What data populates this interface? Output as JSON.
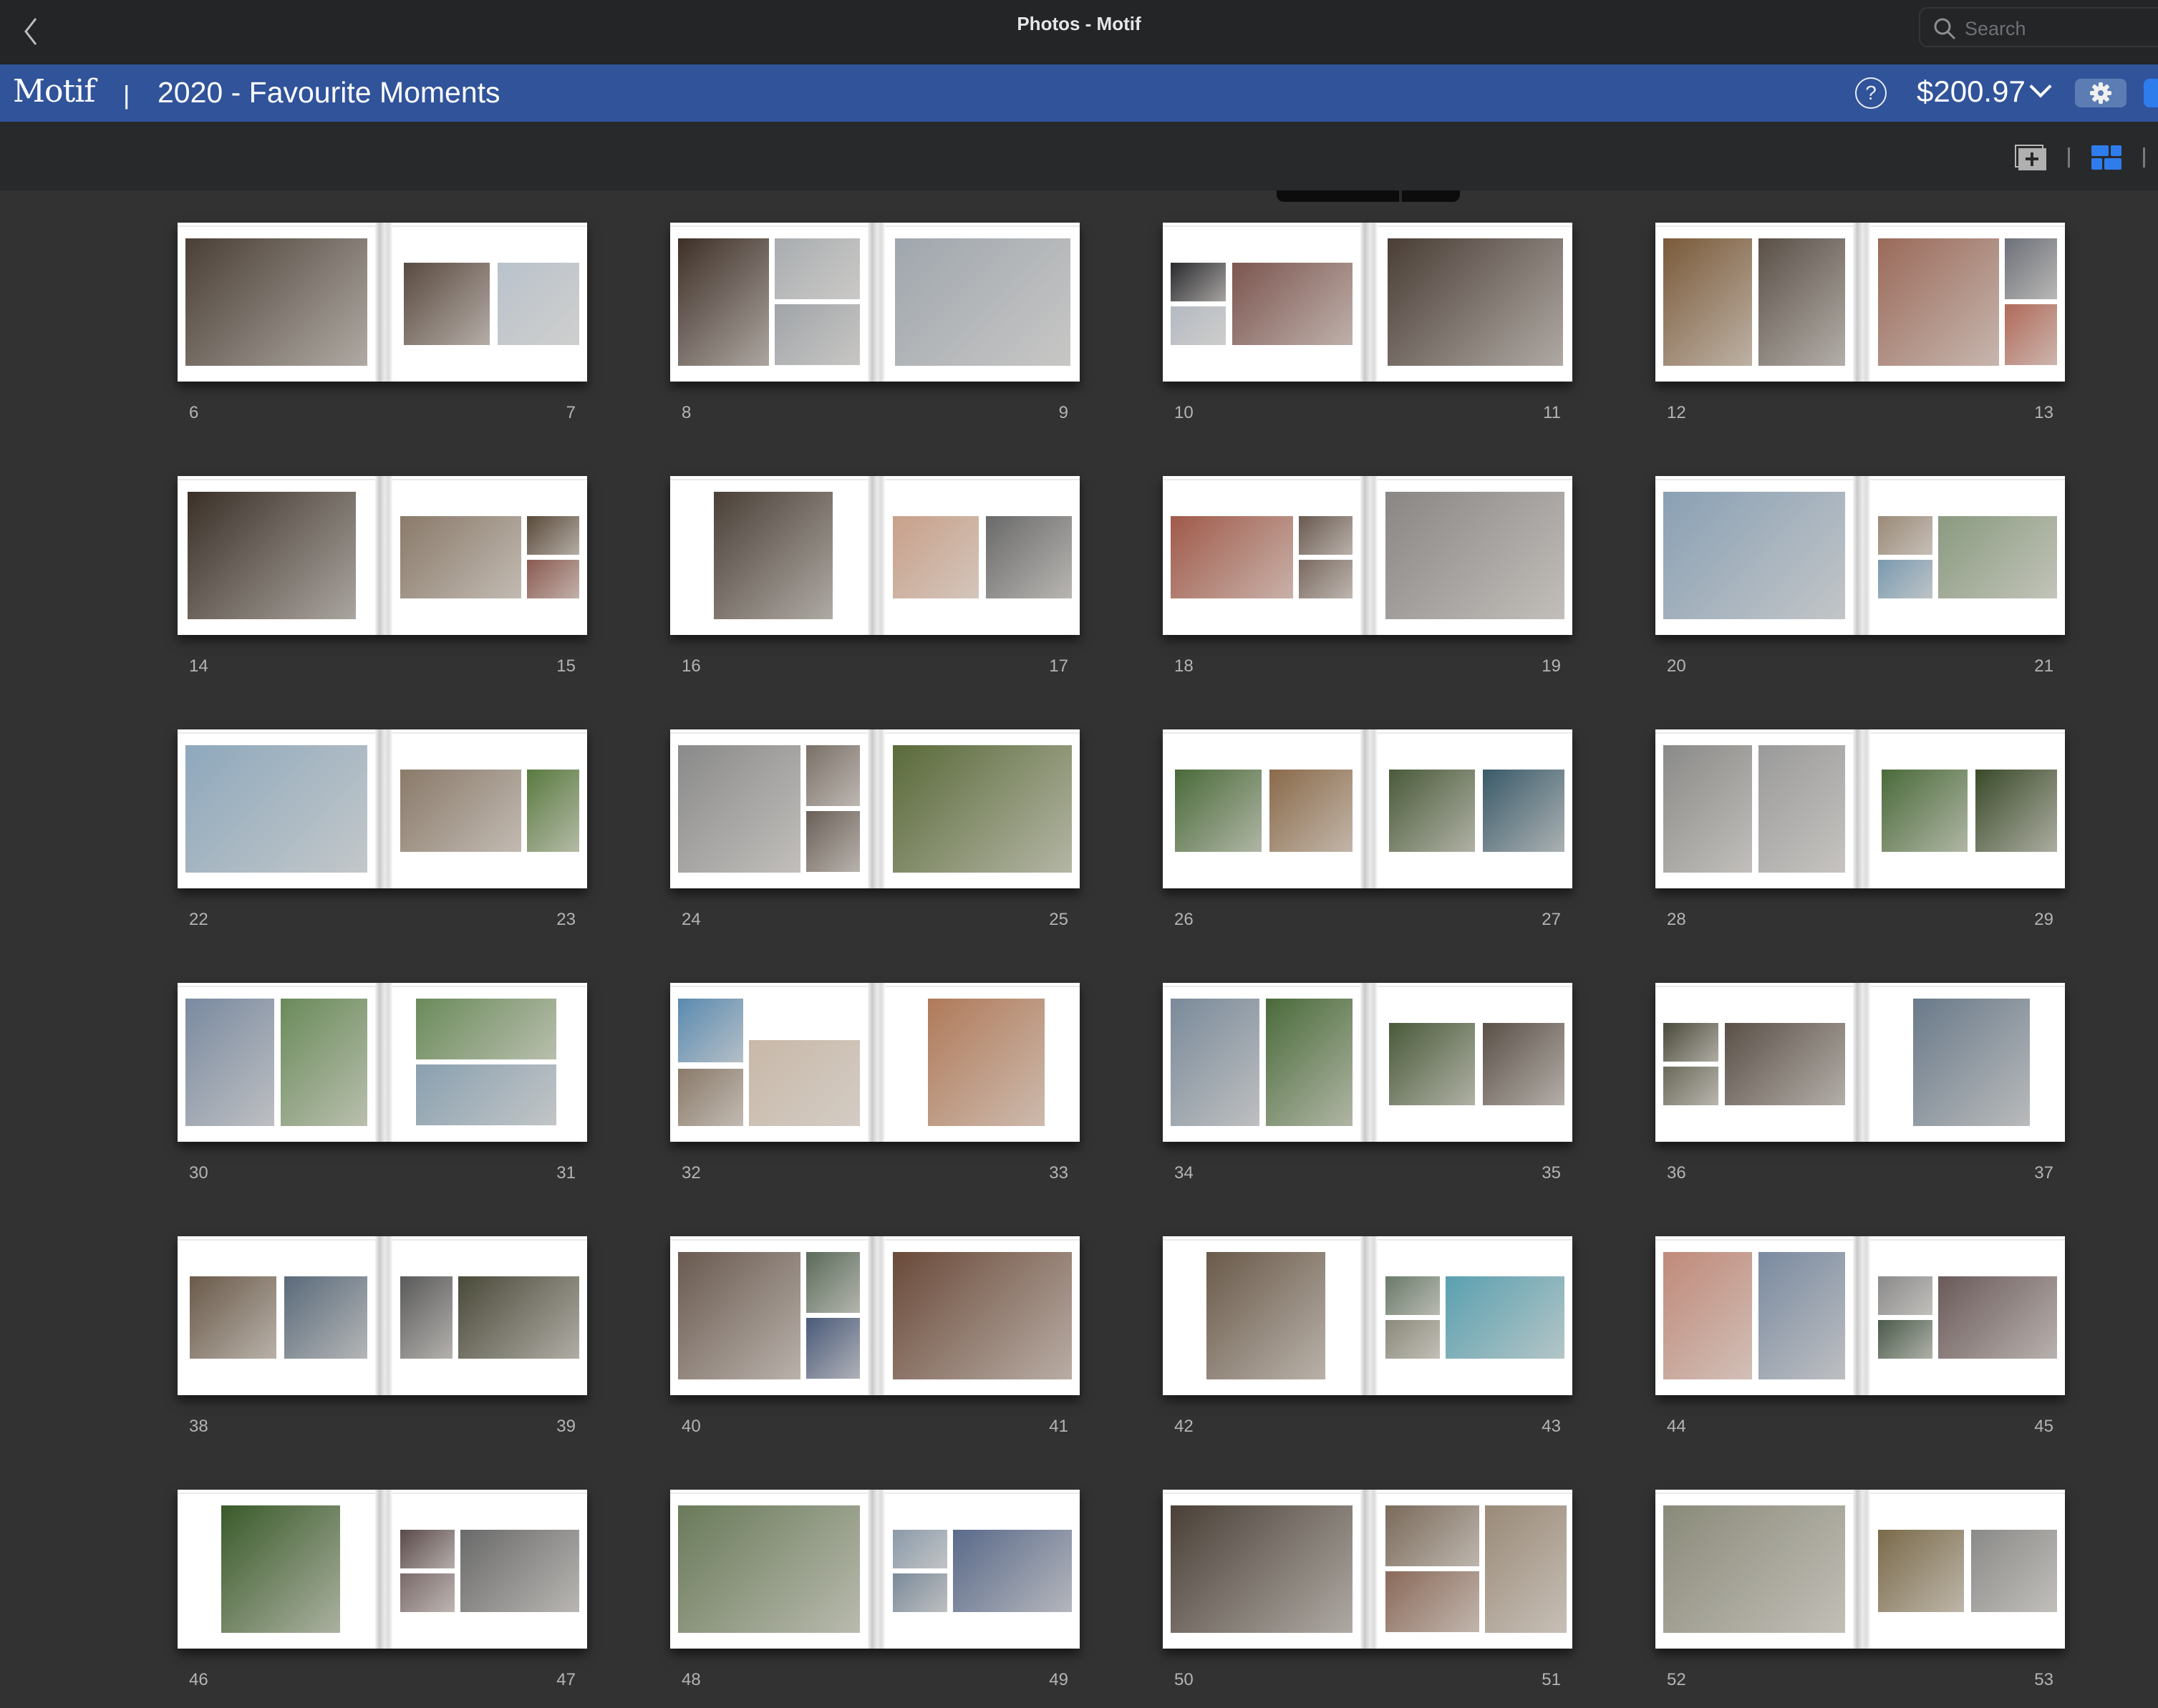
{
  "window": {
    "title": "Photos - Motif",
    "search_placeholder": "Search",
    "search_value": ""
  },
  "header": {
    "brand": "Motif",
    "separator": "|",
    "book_title": "2020 - Favourite Moments",
    "price": "$200.97",
    "help_label": "?"
  },
  "toolbar": {
    "add_page_icon": "add-page-icon",
    "grid_view_icon": "grid-view-icon",
    "grid_view_active_color": "#2f7ced"
  },
  "colors": {
    "title_bar": "#232527",
    "brand_bar": "#30539a",
    "toolbar": "#28292b",
    "canvas": "#323232",
    "page_number": "#b4b4b4"
  },
  "spreads": [
    {
      "left": "6",
      "right": "7",
      "lp": {
        "layout": "single-wide",
        "photos": [
          "#4a3f36"
        ]
      },
      "rp": {
        "layout": "two-mid",
        "photos": [
          "#5a4a40",
          "#b9c2cb"
        ]
      }
    },
    {
      "left": "8",
      "right": "9",
      "lp": {
        "layout": "tall-plus-two",
        "photos": [
          "#3e3028",
          "#a9adb0",
          "#a0a4a8"
        ]
      },
      "rp": {
        "layout": "single-tall",
        "photos": [
          "#9fa6ad"
        ]
      }
    },
    {
      "left": "10",
      "right": "11",
      "lp": {
        "layout": "two-small-plus-big",
        "photos": [
          "#2a2a2e",
          "#b4bac2",
          "#7d5650"
        ]
      },
      "rp": {
        "layout": "single-tall",
        "photos": [
          "#4a3e36"
        ]
      }
    },
    {
      "left": "12",
      "right": "13",
      "lp": {
        "layout": "two-tall",
        "photos": [
          "#7a5a3a",
          "#5a5048"
        ]
      },
      "rp": {
        "layout": "big-plus-two",
        "photos": [
          "#9a6a5a",
          "#6c7078",
          "#b06a5a"
        ]
      }
    },
    {
      "left": "14",
      "right": "15",
      "lp": {
        "layout": "single-tall-left",
        "photos": [
          "#3a3028"
        ]
      },
      "rp": {
        "layout": "big-plus-two-mid",
        "photos": [
          "#8a7a6a",
          "#5a4a3a",
          "#8a5a50"
        ]
      }
    },
    {
      "left": "16",
      "right": "17",
      "lp": {
        "layout": "single-tall-center",
        "photos": [
          "#4a4038"
        ]
      },
      "rp": {
        "layout": "two-mid-equal",
        "photos": [
          "#c8a08a",
          "#6a6a6a"
        ]
      }
    },
    {
      "left": "18",
      "right": "19",
      "lp": {
        "layout": "big-plus-two-mid",
        "photos": [
          "#a05a4a",
          "#6a5a50",
          "#7a6a60"
        ]
      },
      "rp": {
        "layout": "single-wide",
        "photos": [
          "#8a8684"
        ]
      }
    },
    {
      "left": "20",
      "right": "21",
      "lp": {
        "layout": "single-wide",
        "photos": [
          "#8aa0b4"
        ]
      },
      "rp": {
        "layout": "small-stack-plus-big",
        "photos": [
          "#9a8a78",
          "#7a9ab0",
          "#8a9a80"
        ]
      }
    },
    {
      "left": "22",
      "right": "23",
      "lp": {
        "layout": "single-wide",
        "photos": [
          "#8ea8bc"
        ]
      },
      "rp": {
        "layout": "big-plus-narrow",
        "photos": [
          "#8a7a6a",
          "#5a7a40"
        ]
      }
    },
    {
      "left": "24",
      "right": "25",
      "lp": {
        "layout": "big-plus-two",
        "photos": [
          "#8a8a8a",
          "#7a7068",
          "#6a6058"
        ]
      },
      "rp": {
        "layout": "single-wide",
        "photos": [
          "#5a6a3a"
        ]
      }
    },
    {
      "left": "26",
      "right": "27",
      "lp": {
        "layout": "two-mid",
        "photos": [
          "#4a6a3a",
          "#8a6a4a"
        ]
      },
      "rp": {
        "layout": "two-mid",
        "photos": [
          "#4a5a3a",
          "#3a5a6a"
        ]
      }
    },
    {
      "left": "28",
      "right": "29",
      "lp": {
        "layout": "two-tall",
        "photos": [
          "#8a8a88",
          "#9a9a9a"
        ]
      },
      "rp": {
        "layout": "two-mid",
        "photos": [
          "#4a6a3a",
          "#3a4a2a"
        ]
      }
    },
    {
      "left": "30",
      "right": "31",
      "lp": {
        "layout": "two-tall",
        "photos": [
          "#7a8aa0",
          "#6a8a5a"
        ]
      },
      "rp": {
        "layout": "two-stack-center",
        "photos": [
          "#6a8a5a",
          "#8aa0b0"
        ]
      }
    },
    {
      "left": "32",
      "right": "33",
      "lp": {
        "layout": "collage",
        "photos": [
          "#5a8ab0",
          "#8a7a6a",
          "#c8b8a8"
        ]
      },
      "rp": {
        "layout": "single-tall-center",
        "photos": [
          "#b07a5a"
        ]
      }
    },
    {
      "left": "34",
      "right": "35",
      "lp": {
        "layout": "two-tall",
        "photos": [
          "#7a8a9a",
          "#4a6a3a"
        ]
      },
      "rp": {
        "layout": "two-mid",
        "photos": [
          "#4a5a3a",
          "#5a5048"
        ]
      }
    },
    {
      "left": "36",
      "right": "37",
      "lp": {
        "layout": "small-stack-plus-big",
        "photos": [
          "#4a4a3a",
          "#6a6a5a",
          "#5a5048"
        ]
      },
      "rp": {
        "layout": "single-tall-center",
        "photos": [
          "#6a7a8a"
        ]
      }
    },
    {
      "left": "38",
      "right": "39",
      "lp": {
        "layout": "two-mid",
        "photos": [
          "#6a5a4a",
          "#5a6a7a"
        ]
      },
      "rp": {
        "layout": "narrow-plus-big",
        "photos": [
          "#5a5a5a",
          "#4a4a3a"
        ]
      }
    },
    {
      "left": "40",
      "right": "41",
      "lp": {
        "layout": "big-plus-two",
        "photos": [
          "#6a5a50",
          "#5a6a5a",
          "#4a5a7a"
        ]
      },
      "rp": {
        "layout": "single-wide",
        "photos": [
          "#6a4a3a"
        ]
      }
    },
    {
      "left": "42",
      "right": "43",
      "lp": {
        "layout": "single-tall-center",
        "photos": [
          "#6a5a4a"
        ]
      },
      "rp": {
        "layout": "small-stack-plus-big",
        "photos": [
          "#6a7a6a",
          "#8a8a7a",
          "#5aa0b0"
        ]
      }
    },
    {
      "left": "44",
      "right": "45",
      "lp": {
        "layout": "two-tall",
        "photos": [
          "#c08a7a",
          "#7a8aa0"
        ]
      },
      "rp": {
        "layout": "small-stack-plus-big",
        "photos": [
          "#8a8a8a",
          "#4a5a4a",
          "#6a5a5a"
        ]
      }
    },
    {
      "left": "46",
      "right": "47",
      "lp": {
        "layout": "single-tall-center",
        "photos": [
          "#3a5a2a"
        ]
      },
      "rp": {
        "layout": "small-stack-plus-big",
        "photos": [
          "#5a4a4a",
          "#7a6a6a",
          "#6a6a6a"
        ]
      }
    },
    {
      "left": "48",
      "right": "49",
      "lp": {
        "layout": "single-wide",
        "photos": [
          "#6a7a5a"
        ]
      },
      "rp": {
        "layout": "small-stack-plus-big",
        "photos": [
          "#8a9aaa",
          "#7a8a9a",
          "#5a6a8a"
        ]
      }
    },
    {
      "left": "50",
      "right": "51",
      "lp": {
        "layout": "single-wide",
        "photos": [
          "#4a4038"
        ]
      },
      "rp": {
        "layout": "two-small-plus-big-r",
        "photos": [
          "#7a6a5a",
          "#8a6a5a",
          "#9a8a78"
        ]
      }
    },
    {
      "left": "52",
      "right": "53",
      "lp": {
        "layout": "single-wide",
        "photos": [
          "#8a8a7a"
        ]
      },
      "rp": {
        "layout": "two-mid-equal",
        "photos": [
          "#7a6a4a",
          "#8a8a88"
        ]
      }
    }
  ]
}
